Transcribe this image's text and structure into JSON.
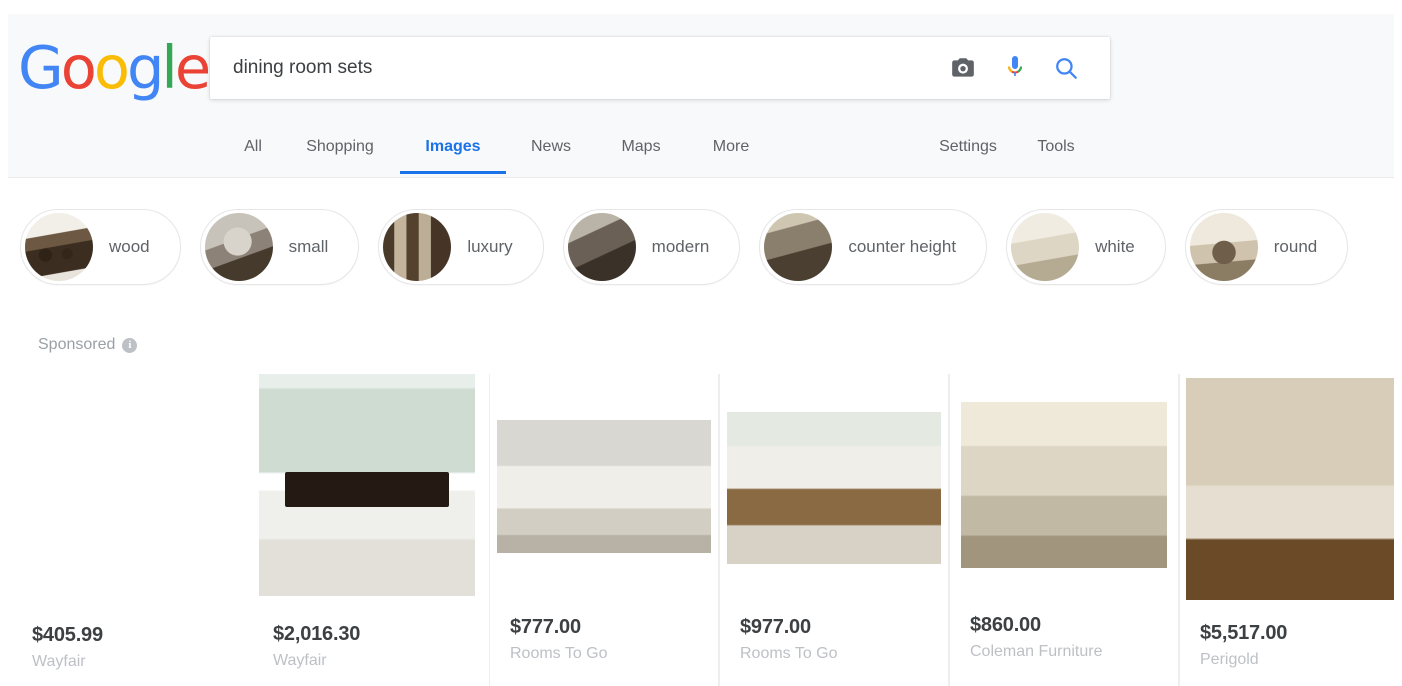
{
  "brand": {
    "logo_letters": [
      {
        "char": "G",
        "color": "#4285f4"
      },
      {
        "char": "o",
        "color": "#ea4335"
      },
      {
        "char": "o",
        "color": "#fbbc05"
      },
      {
        "char": "g",
        "color": "#4285f4"
      },
      {
        "char": "l",
        "color": "#34a853"
      },
      {
        "char": "e",
        "color": "#ea4335"
      }
    ]
  },
  "search": {
    "query": "dining room sets",
    "placeholder": "Search",
    "camera_icon": "camera-icon",
    "mic_icon": "microphone-icon",
    "search_icon": "search-icon"
  },
  "nav": {
    "left_items": [
      {
        "label": "All",
        "active": false
      },
      {
        "label": "Shopping",
        "active": false
      },
      {
        "label": "Images",
        "active": true
      },
      {
        "label": "News",
        "active": false
      },
      {
        "label": "Maps",
        "active": false
      },
      {
        "label": "More",
        "active": false
      }
    ],
    "right_items": [
      {
        "label": "Settings"
      },
      {
        "label": "Tools"
      }
    ],
    "active_color": "#1a73e8"
  },
  "chips": [
    {
      "label": "wood",
      "thumb": "t-wood"
    },
    {
      "label": "small",
      "thumb": "t-small"
    },
    {
      "label": "luxury",
      "thumb": "t-luxury"
    },
    {
      "label": "modern",
      "thumb": "t-modern"
    },
    {
      "label": "counter height",
      "thumb": "t-counter"
    },
    {
      "label": "white",
      "thumb": "t-white"
    },
    {
      "label": "round",
      "thumb": "t-round"
    }
  ],
  "sponsored": {
    "label": "Sponsored",
    "info_icon": "info-icon",
    "info_glyph": "i"
  },
  "products": [
    {
      "price": "$405.99",
      "merchant": "Wayfair",
      "photo": "p1"
    },
    {
      "price": "$2,016.30",
      "merchant": "Wayfair",
      "photo": "p2"
    },
    {
      "price": "$777.00",
      "merchant": "Rooms To Go",
      "photo": "p3"
    },
    {
      "price": "$977.00",
      "merchant": "Rooms To Go",
      "photo": "p4"
    },
    {
      "price": "$860.00",
      "merchant": "Coleman Furniture",
      "photo": "p5"
    },
    {
      "price": "$5,517.00",
      "merchant": "Perigold",
      "photo": "p6"
    }
  ]
}
